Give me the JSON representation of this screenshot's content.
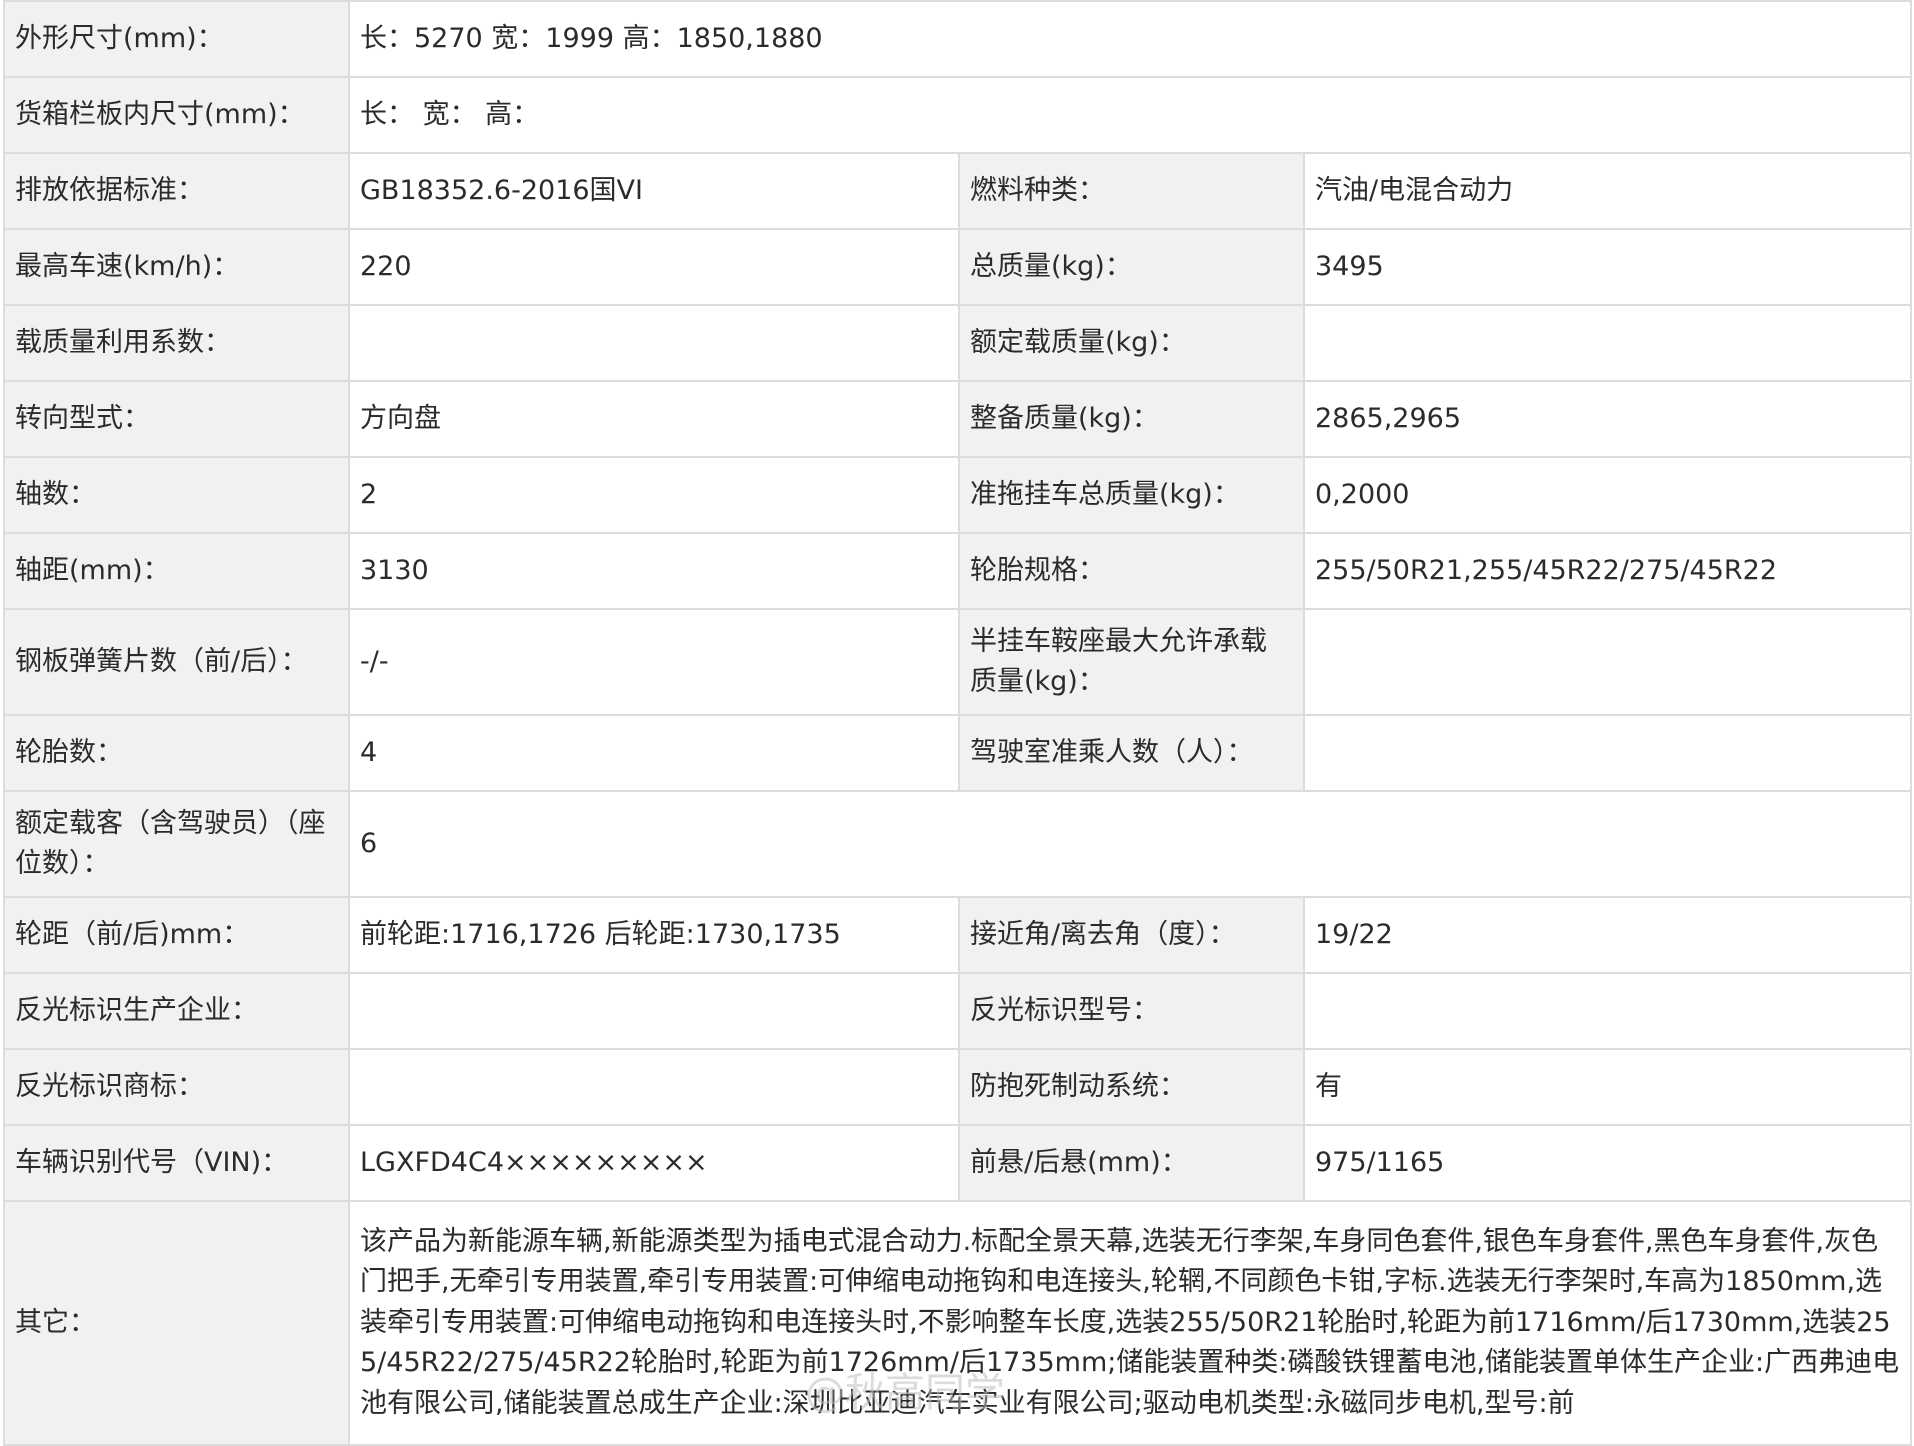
{
  "rows": {
    "dimensions": {
      "label": "外形尺寸(mm)：",
      "value": "长：5270 宽：1999 高：1850,1880"
    },
    "cargo_box": {
      "label": "货箱栏板内尺寸(mm)：",
      "value": "长：  宽：  高："
    },
    "emission": {
      "label": "排放依据标准：",
      "value": "GB18352.6-2016国VI",
      "label2": "燃料种类：",
      "value2": "汽油/电混合动力"
    },
    "max_speed": {
      "label": "最高车速(km/h)：",
      "value": "220",
      "label2": "总质量(kg)：",
      "value2": "3495"
    },
    "load_coef": {
      "label": "载质量利用系数：",
      "value": "",
      "label2": "额定载质量(kg)：",
      "value2": ""
    },
    "steering": {
      "label": "转向型式：",
      "value": "方向盘",
      "label2": "整备质量(kg)：",
      "value2": "2865,2965"
    },
    "axles": {
      "label": "轴数：",
      "value": "2",
      "label2": "准拖挂车总质量(kg)：",
      "value2": "0,2000"
    },
    "wheelbase": {
      "label": "轴距(mm)：",
      "value": "3130",
      "label2": "轮胎规格：",
      "value2": "255/50R21,255/45R22/275/45R22"
    },
    "leaf_springs": {
      "label": "钢板弹簧片数（前/后）：",
      "value": "-/-",
      "label2": "半挂车鞍座最大允许承载质量(kg)：",
      "value2": ""
    },
    "tires": {
      "label": "轮胎数：",
      "value": "4",
      "label2": "驾驶室准乘人数（人）：",
      "value2": ""
    },
    "passengers": {
      "label": "额定载客（含驾驶员）（座位数）：",
      "value": "6"
    },
    "track": {
      "label": "轮距（前/后)mm：",
      "value": "前轮距:1716,1726 后轮距:1730,1735",
      "label2": "接近角/离去角（度）：",
      "value2": "19/22"
    },
    "reflector_maker": {
      "label": "反光标识生产企业：",
      "value": "",
      "label2": "反光标识型号：",
      "value2": ""
    },
    "reflector_brand": {
      "label": "反光标识商标：",
      "value": "",
      "label2": "防抱死制动系统：",
      "value2": "有"
    },
    "vin": {
      "label": "车辆识别代号（VIN)：",
      "value": "LGXFD4C4×××××××××",
      "label2": "前悬/后悬(mm)：",
      "value2": "975/1165"
    },
    "other": {
      "label": "其它：",
      "value": "该产品为新能源车辆,新能源类型为插电式混合动力.标配全景天幕,选装无行李架,车身同色套件,银色车身套件,黑色车身套件,灰色门把手,无牵引专用装置,牵引专用装置:可伸缩电动拖钩和电连接头,轮辋,不同颜色卡钳,字标.选装无行李架时,车高为1850mm,选装牵引专用装置:可伸缩电动拖钩和电连接头时,不影响整车长度,选装255/50R21轮胎时,轮距为前1716mm/后1730mm,选装255/45R22/275/45R22轮胎时,轮距为前1726mm/后1735mm;储能装置种类:磷酸铁锂蓄电池,储能装置单体生产企业:广西弗迪电池有限公司,储能装置总成生产企业:深圳比亚迪汽车实业有限公司;驱动电机类型:永磁同步电机,型号:前"
    }
  },
  "watermark": "@秋高同学"
}
